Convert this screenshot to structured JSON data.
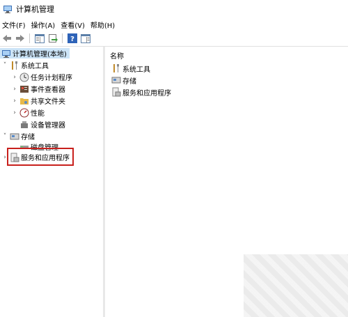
{
  "window": {
    "title": "计算机管理"
  },
  "menu": [
    "文件(F)",
    "操作(A)",
    "查看(V)",
    "帮助(H)"
  ],
  "tree": [
    {
      "label": "计算机管理(本地)",
      "expander": "",
      "icon": "computer-management-icon"
    },
    {
      "label": "系统工具",
      "expander": "˅",
      "icon": "tools-icon"
    },
    {
      "label": "任务计划程序",
      "expander": "›",
      "icon": "clock-icon"
    },
    {
      "label": "事件查看器",
      "expander": "›",
      "icon": "event-viewer-icon"
    },
    {
      "label": "共享文件夹",
      "expander": "›",
      "icon": "shared-folder-icon"
    },
    {
      "label": "性能",
      "expander": "›",
      "icon": "performance-icon"
    },
    {
      "label": "设备管理器",
      "expander": "",
      "icon": "device-manager-icon"
    },
    {
      "label": "存储",
      "expander": "˅",
      "icon": "storage-icon"
    },
    {
      "label": "磁盘管理",
      "expander": "",
      "icon": "disk-icon"
    },
    {
      "label": "服务和应用程序",
      "expander": "›",
      "icon": "services-icon"
    }
  ],
  "list": {
    "header": "名称",
    "items": [
      {
        "label": "系统工具",
        "icon": "tools-icon"
      },
      {
        "label": "存储",
        "icon": "storage-icon"
      },
      {
        "label": "服务和应用程序",
        "icon": "services-icon"
      }
    ]
  }
}
